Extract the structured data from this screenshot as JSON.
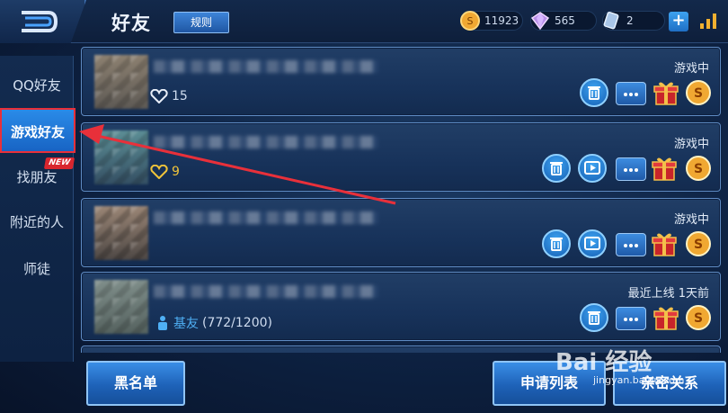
{
  "header": {
    "title": "好友",
    "rules_label": "规则",
    "gold": "11923",
    "diamond": "565",
    "voucher": "2",
    "plus_label": "+"
  },
  "sidebar": {
    "items": [
      {
        "label": "QQ好友"
      },
      {
        "label": "游戏好友"
      },
      {
        "label": "找朋友"
      },
      {
        "label": "附近的人"
      },
      {
        "label": "师徒"
      }
    ],
    "new_badge": "NEW"
  },
  "friends": [
    {
      "status": "游戏中",
      "meta": "15",
      "meta_type": "intimacy"
    },
    {
      "status": "游戏中",
      "meta": "9",
      "meta_type": "intimacy-gold"
    },
    {
      "status": "游戏中",
      "meta": "",
      "meta_type": "none"
    },
    {
      "status": "最近上线  1天前",
      "meta": "基友",
      "meta_value": "(772/1200)",
      "meta_type": "relation"
    }
  ],
  "bottom": {
    "blacklist_label": "黑名单",
    "requests_label": "申请列表",
    "intimate_label": "亲密关系"
  },
  "watermark": {
    "brand": "Bai 经验",
    "url": "jingyan.baidu.com"
  },
  "colors": {
    "accent": "#1f6fc4",
    "active_tab_border": "#e8303a",
    "badge": "#d9262e",
    "gold_text": "#f0c43a"
  }
}
